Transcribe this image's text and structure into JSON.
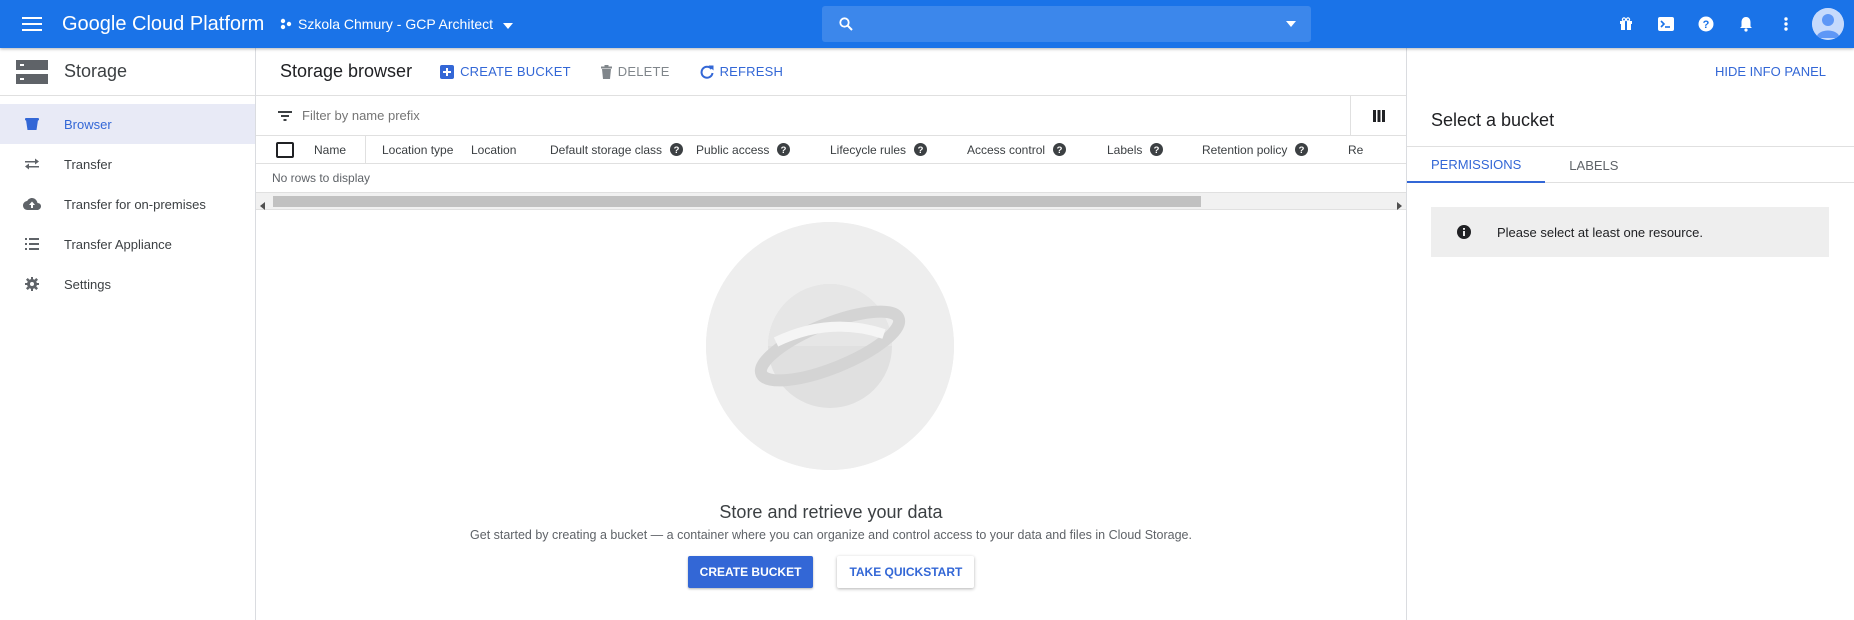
{
  "header": {
    "brand": "Google Cloud Platform",
    "project": "Szkola Chmury - GCP Architect",
    "search_placeholder": "",
    "icons": [
      "menu-icon",
      "project-dots-icon",
      "search-icon",
      "gift-icon",
      "cloud-shell-icon",
      "help-icon",
      "notifications-icon",
      "more-vert-icon",
      "account-avatar"
    ]
  },
  "sidebar": {
    "title": "Storage",
    "items": [
      {
        "label": "Browser",
        "icon": "bucket-icon",
        "active": true
      },
      {
        "label": "Transfer",
        "icon": "transfer-arrows-icon",
        "active": false
      },
      {
        "label": "Transfer for on-premises",
        "icon": "cloud-upload-icon",
        "active": false
      },
      {
        "label": "Transfer Appliance",
        "icon": "list-icon",
        "active": false
      },
      {
        "label": "Settings",
        "icon": "gear-icon",
        "active": false
      }
    ]
  },
  "main": {
    "title": "Storage browser",
    "toolbar": {
      "create": "CREATE BUCKET",
      "delete": "DELETE",
      "refresh": "REFRESH"
    },
    "filter_placeholder": "Filter by name prefix",
    "columns": [
      {
        "label": "Name",
        "help": false
      },
      {
        "label": "Location type",
        "help": false
      },
      {
        "label": "Location",
        "help": false
      },
      {
        "label": "Default storage class",
        "help": true
      },
      {
        "label": "Public access",
        "help": true
      },
      {
        "label": "Lifecycle rules",
        "help": true
      },
      {
        "label": "Access control",
        "help": true
      },
      {
        "label": "Labels",
        "help": true
      },
      {
        "label": "Retention policy",
        "help": true
      },
      {
        "label": "Re",
        "help": false
      }
    ],
    "no_rows": "No rows to display",
    "empty_state": {
      "title": "Store and retrieve your data",
      "description": "Get started by creating a bucket — a container where you can organize and control access to your data and files in Cloud Storage.",
      "primary_button": "CREATE BUCKET",
      "secondary_button": "TAKE QUICKSTART"
    }
  },
  "info_panel": {
    "hide_label": "HIDE INFO PANEL",
    "title": "Select a bucket",
    "tabs": [
      {
        "label": "PERMISSIONS",
        "active": true
      },
      {
        "label": "LABELS",
        "active": false
      }
    ],
    "message": "Please select at least one resource."
  },
  "colors": {
    "topbar": "#1a73e8",
    "accent": "#3367d6",
    "active_nav_bg": "#e8eaf6"
  }
}
